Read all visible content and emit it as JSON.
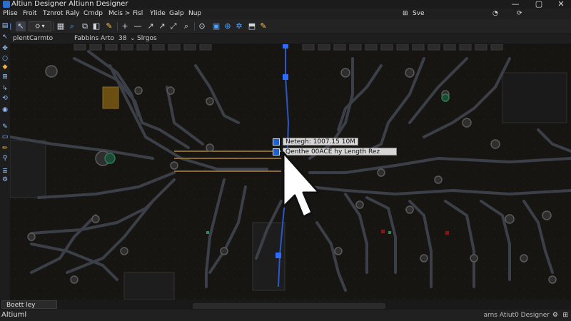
{
  "window": {
    "title": "Altiun Designer  Altiunn Designer",
    "controls": [
      "—",
      "▢",
      "✕"
    ]
  },
  "menu": {
    "items": [
      "Plise",
      "Froit",
      "Tznrot",
      "Raly",
      "Crndp",
      "Mcis >",
      "Fisl",
      "Ylide",
      "Galp",
      "Nup"
    ],
    "search_label": "Sve",
    "right_icons": [
      "⊞",
      "◔",
      "⟳"
    ]
  },
  "toolbar2": {
    "project": "plentCarmto",
    "board": "Fabbins Arto",
    "zoom": "38",
    "mode": "Slrgos"
  },
  "tooltip": {
    "line1": "Netegh: 1007.15 10M",
    "line2": "Qenthe 00ACE hy Length Rez"
  },
  "tabs": {
    "active": "Boett ley"
  },
  "status": {
    "left": "Altiuml",
    "right": "arns Atiut0 Designer"
  }
}
